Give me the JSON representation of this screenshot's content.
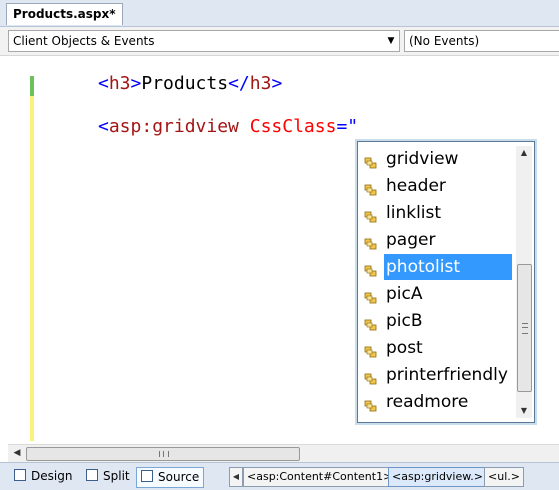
{
  "document_tab": {
    "label": "Products.aspx*"
  },
  "dropdowns": {
    "objects": {
      "selected": "Client Objects & Events"
    },
    "events": {
      "selected": "(No Events)"
    }
  },
  "code": {
    "line1": {
      "open_bracket": "<",
      "tag": "h3",
      "close_bracket": ">",
      "text": "Products",
      "end_open": "</",
      "end_tag": "h3",
      "end_close": ">"
    },
    "line2": {
      "open_bracket": "<",
      "tag": "asp:gridview",
      "attr": "CssClass",
      "eq": "=\""
    }
  },
  "intellisense": {
    "items": [
      {
        "label": "gridview"
      },
      {
        "label": "header"
      },
      {
        "label": "linklist"
      },
      {
        "label": "pager"
      },
      {
        "label": "photolist"
      },
      {
        "label": "picA"
      },
      {
        "label": "picB"
      },
      {
        "label": "post"
      },
      {
        "label": "printerfriendly"
      },
      {
        "label": "readmore"
      }
    ],
    "selected": "photolist",
    "item_icon": "css-class-icon"
  },
  "bottom_bar": {
    "design": "Design",
    "split": "Split",
    "source": "Source",
    "breadcrumbs": [
      "<asp:Content#Content1>",
      "<asp:gridview.>",
      "<ul.>"
    ]
  },
  "colors": {
    "accent": "#3399ff",
    "tag": "#a31515",
    "bracket": "#0000ff",
    "attribute": "#ff0000"
  }
}
